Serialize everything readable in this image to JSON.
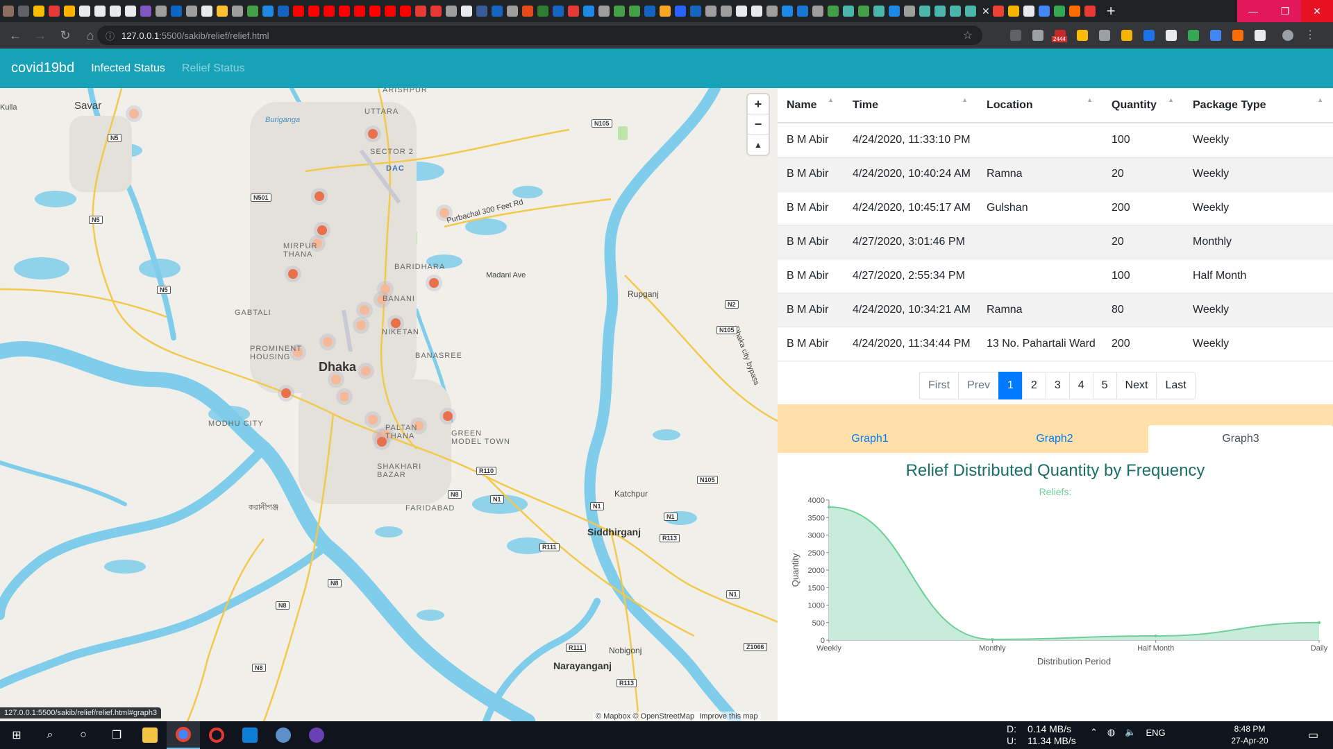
{
  "browser": {
    "url_host": "127.0.0.1",
    "url_path": ":5500/sakib/relief/relief.html",
    "status_url": "127.0.0.1:5500/sakib/relief/relief.html#graph3",
    "notif_badge": "2444"
  },
  "navbar": {
    "brand": "covid19bd",
    "links": [
      "Infected Status",
      "Relief Status"
    ]
  },
  "map": {
    "labels": {
      "savar": "Savar",
      "kulla": "Kulla",
      "uttara": "UTTARA",
      "sector2": "SECTOR 2",
      "dac": "DAC",
      "buriganga": "Buriganga",
      "mirpur": "MIRPUR THANA",
      "baridhara": "BARIDHARA",
      "banani": "BANANI",
      "niketan": "NIKETAN",
      "gabtali": "GABTALI",
      "prominent": "PROMINENT HOUSING",
      "banasree": "BANASREE",
      "dhaka": "Dhaka",
      "modhu": "MODHU CITY",
      "paltan": "PALTAN THANA",
      "greenmodel": "GREEN MODEL TOWN",
      "shakhari": "SHAKHARI BAZAR",
      "faridabad": "FARIDABAD",
      "katchpur": "Katchpur",
      "siddhirganj": "Siddhirganj",
      "narayanganj": "Narayanganj",
      "nobigonj": "Nobigonj",
      "rupganj": "Rupganj",
      "purbachal": "Purbachal 300 Feet Rd",
      "madani": "Madani Ave",
      "bypass": "Dhaka city bypass",
      "karaniganj": "করানীগঞ্জ",
      "arishpur": "ARISHPUR"
    },
    "shields": [
      "N5",
      "N501",
      "N5",
      "N5",
      "N105",
      "N2",
      "N105",
      "R110",
      "N8",
      "N1",
      "N1",
      "R113",
      "R111",
      "N1",
      "N105",
      "N8",
      "N8",
      "N8",
      "R111",
      "Z1066",
      "R113",
      "N1"
    ],
    "attribution": "© Mapbox © OpenStreetMap",
    "improve": "Improve this map",
    "zoom_in": "+",
    "zoom_out": "−",
    "compass": "▲"
  },
  "table": {
    "headers": [
      "Name",
      "Time",
      "Location",
      "Quantity",
      "Package Type"
    ],
    "rows": [
      [
        "B M Abir",
        "4/24/2020, 11:33:10 PM",
        "",
        "100",
        "Weekly"
      ],
      [
        "B M Abir",
        "4/24/2020, 10:40:24 AM",
        "Ramna",
        "20",
        "Weekly"
      ],
      [
        "B M Abir",
        "4/24/2020, 10:45:17 AM",
        "Gulshan",
        "200",
        "Weekly"
      ],
      [
        "B M Abir",
        "4/27/2020, 3:01:46 PM",
        "",
        "20",
        "Monthly"
      ],
      [
        "B M Abir",
        "4/27/2020, 2:55:34 PM",
        "",
        "100",
        "Half Month"
      ],
      [
        "B M Abir",
        "4/24/2020, 10:34:21 AM",
        "Ramna",
        "80",
        "Weekly"
      ],
      [
        "B M Abir",
        "4/24/2020, 11:34:44 PM",
        "13 No. Pahartali Ward",
        "200",
        "Weekly"
      ]
    ]
  },
  "pager": [
    "First",
    "Prev",
    "1",
    "2",
    "3",
    "4",
    "5",
    "Next",
    "Last"
  ],
  "graph_tabs": [
    "Graph1",
    "Graph2",
    "Graph3"
  ],
  "chart_data": {
    "type": "area",
    "title": "Relief Distributed Quantity by Frequency",
    "subtitle": "Reliefs:",
    "xlabel": "Distribution Period",
    "ylabel": "Quantity",
    "categories": [
      "Weekly",
      "Monthly",
      "Half Month",
      "Daily"
    ],
    "values": [
      3800,
      20,
      120,
      500
    ],
    "ylim": [
      0,
      4000
    ],
    "yticks": [
      0,
      500,
      1000,
      1500,
      2000,
      2500,
      3000,
      3500,
      4000
    ],
    "color": "#6fcf97",
    "fill": "#c8ecdc"
  },
  "taskbar": {
    "net_down": "0.14 MB/s",
    "net_up": "11.34 MB/s",
    "net_down_label": "D:",
    "net_up_label": "U:",
    "lang": "ENG",
    "time": "8:48 PM",
    "date": "27-Apr-20"
  }
}
